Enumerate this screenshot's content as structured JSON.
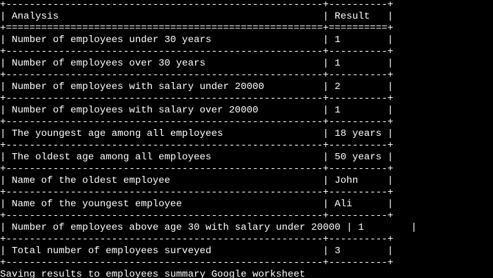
{
  "terminal": {
    "lines": [
      "+------------------------------------------------------+----------+",
      "| Analysis                                             | Result   |",
      "+======================================================+==========+",
      "| Number of employees under 30 years                   | 1        |",
      "+------------------------------------------------------+----------+",
      "| Number of employees over 30 years                    | 1        |",
      "+------------------------------------------------------+----------+",
      "| Number of employees with salary under 20000          | 2        |",
      "+------------------------------------------------------+----------+",
      "| Number of employees with salary over 20000           | 1        |",
      "+------------------------------------------------------+----------+",
      "| The youngest age among all employees                 | 18 years |",
      "+------------------------------------------------------+----------+",
      "| The oldest age among all employees                   | 50 years |",
      "+------------------------------------------------------+----------+",
      "| Name of the oldest employee                          | John     |",
      "+------------------------------------------------------+----------+",
      "| Name of the youngest employee                        | Ali      |",
      "+------------------------------------------------------+----------+",
      "| Number of employees above age 30 with salary under 20000 | 1        |",
      "+------------------------------------------------------+----------+",
      "| Total number of employees surveyed                   | 3        |",
      "+------------------------------------------------------+----------+",
      "Saving results to employees summary Google worksheet"
    ]
  },
  "colors": {
    "background": "#000000",
    "foreground": "#ffffff"
  }
}
